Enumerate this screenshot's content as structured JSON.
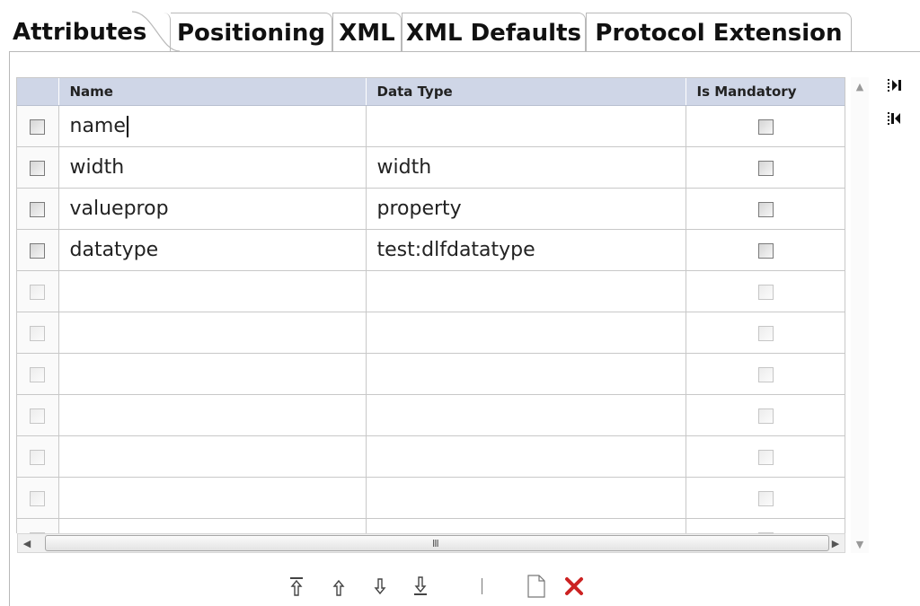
{
  "tabs": [
    {
      "label": "Attributes"
    },
    {
      "label": "Positioning"
    },
    {
      "label": "XML"
    },
    {
      "label": "XML Defaults"
    },
    {
      "label": "Protocol Extension"
    }
  ],
  "active_tab": "Attributes",
  "table": {
    "columns": [
      "Name",
      "Data Type",
      "Is Mandatory"
    ],
    "rows": [
      {
        "name": "name",
        "data_type": ""
      },
      {
        "name": "width",
        "data_type": "width"
      },
      {
        "name": "valueprop",
        "data_type": "property"
      },
      {
        "name": "datatype",
        "data_type": "test:dlfdatatype"
      }
    ],
    "empty_row_count": 7
  },
  "scrollbar": {
    "grip": "III"
  },
  "icons": {
    "tab_forward": "skip-forward-icon",
    "tab_backward": "skip-backward-icon",
    "move_top": "move-top-icon",
    "move_up": "move-up-icon",
    "move_down": "move-down-icon",
    "move_bottom": "move-bottom-icon",
    "new": "new-document-icon",
    "delete": "delete-x-icon"
  },
  "colors": {
    "header_bg": "#cfd6e7",
    "delete_red": "#cc2222"
  }
}
